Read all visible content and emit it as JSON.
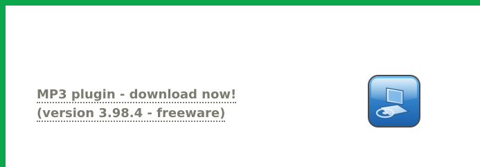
{
  "download": {
    "line1": "MP3 plugin - download now!",
    "line2": "(version 3.98.4 - freeware)"
  },
  "icon": {
    "name": "download-software-icon",
    "color": "#2f7fc8"
  },
  "colors": {
    "border": "#0aa84b",
    "link_text": "#7b7b70"
  }
}
